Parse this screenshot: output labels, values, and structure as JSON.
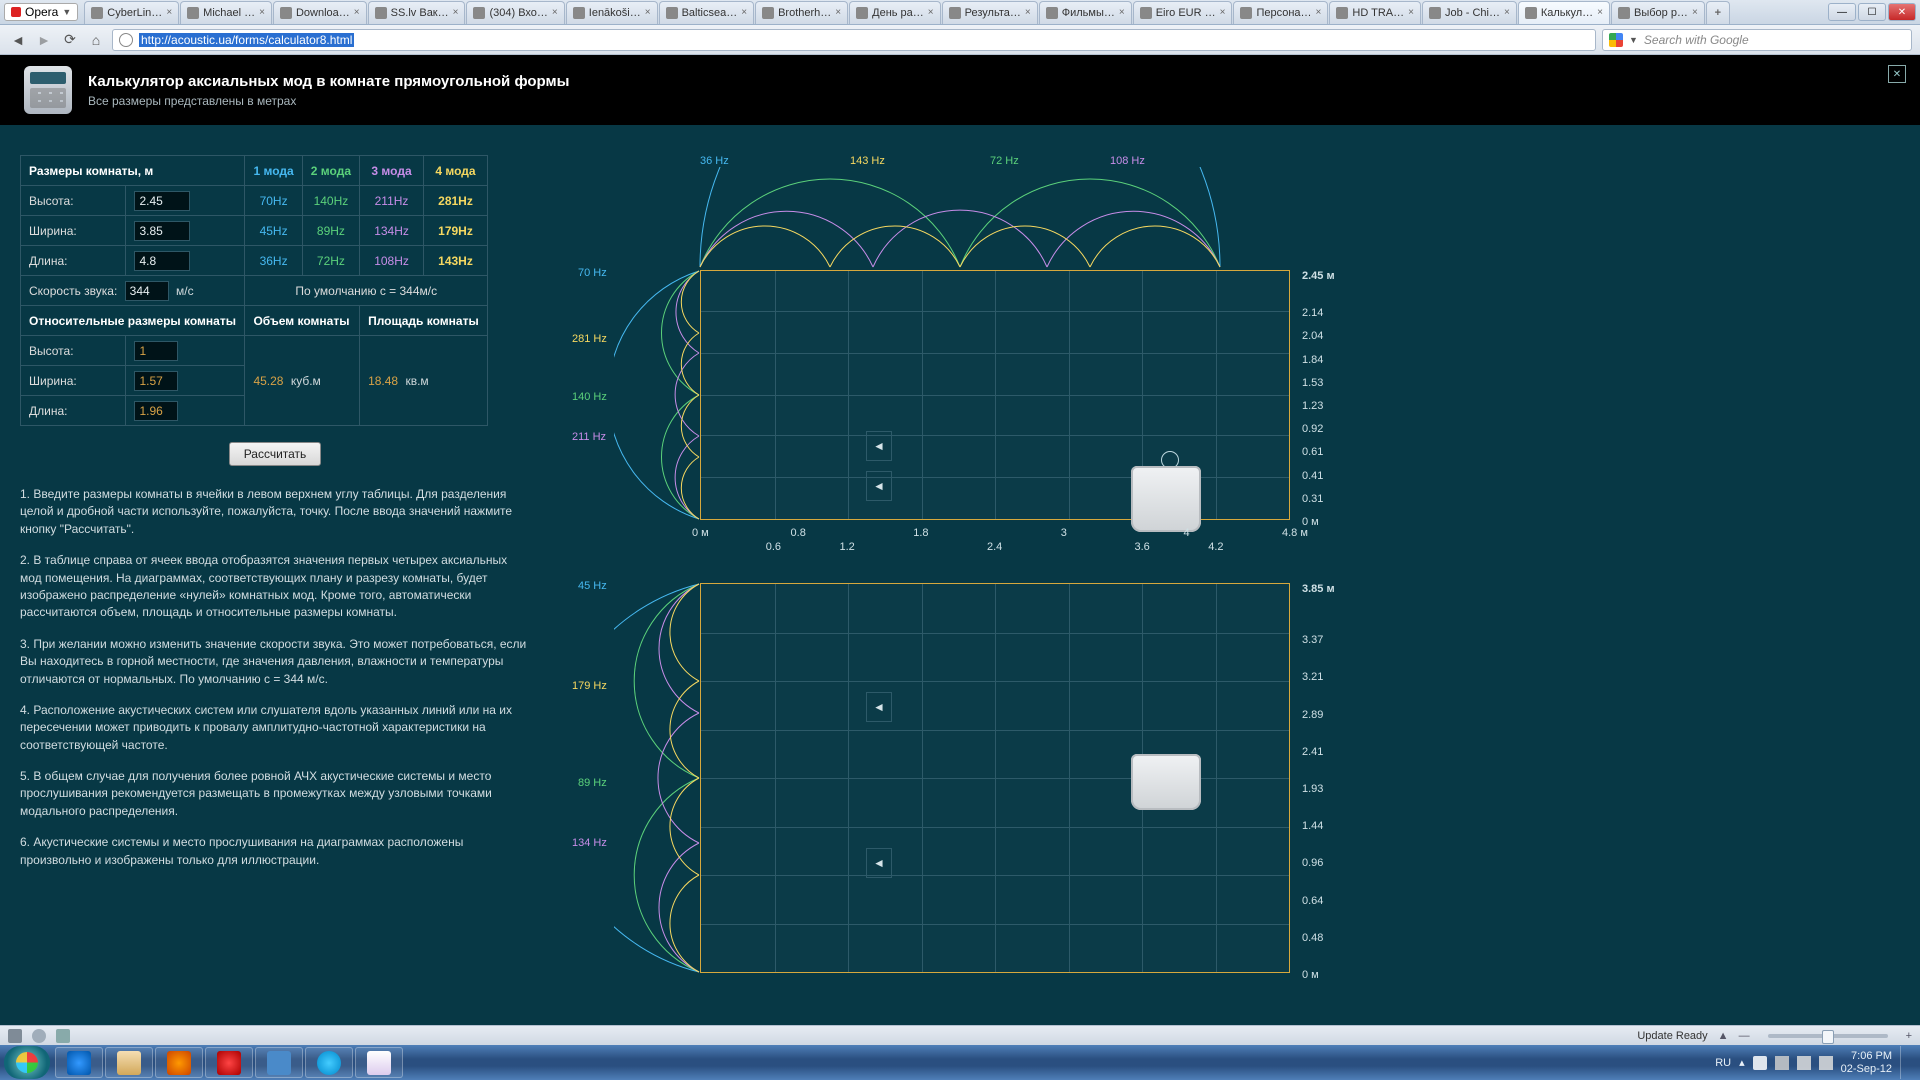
{
  "window": {
    "app": "Opera",
    "tabs": [
      "CyberLin…",
      "Michael …",
      "Downloa…",
      "SS.lv Вак…",
      "(304) Вхо…",
      "Ienākoši…",
      "Balticsea…",
      "Brotherh…",
      "День ра…",
      "Результа…",
      "Фильмы…",
      "Eiro EUR …",
      "Персона…",
      "HD TRA…",
      "Job - Chi…",
      "Калькул…",
      "Выбор р…"
    ],
    "active_tab": 15,
    "url": "http://acoustic.ua/forms/calculator8.html",
    "search_placeholder": "Search with Google",
    "min": "—",
    "max": "☐",
    "close": "✕"
  },
  "header": {
    "title": "Калькулятор аксиальных мод в комнате прямоугольной формы",
    "subtitle": "Все размеры представлены в метрах"
  },
  "table": {
    "room_dims_header": "Размеры комнаты, м",
    "m1": "1 мода",
    "m2": "2 мода",
    "m3": "3 мода",
    "m4": "4 мода",
    "h_label": "Высота:",
    "w_label": "Ширина:",
    "l_label": "Длина:",
    "h": "2.45",
    "w": "3.85",
    "l": "4.8",
    "row_h": [
      "70Hz",
      "140Hz",
      "211Hz",
      "281Hz"
    ],
    "row_w": [
      "45Hz",
      "89Hz",
      "134Hz",
      "179Hz"
    ],
    "row_l": [
      "36Hz",
      "72Hz",
      "108Hz",
      "143Hz"
    ],
    "speed_label": "Скорость звука:",
    "speed": "344",
    "speed_unit": "м/с",
    "speed_note": "По  умолчанию с = 344м/с",
    "rel_header": "Относительные размеры комнаты",
    "vol_header": "Объем комнаты",
    "area_header": "Площадь комнаты",
    "rel_h": "1",
    "rel_w": "1.57",
    "rel_l": "1.96",
    "volume": "45.28",
    "vol_unit": "куб.м",
    "area": "18.48",
    "area_unit": "кв.м",
    "calc_btn": "Рассчитать"
  },
  "instructions": [
    "1. Введите размеры комнаты в ячейки в левом верхнем углу таблицы. Для разделения целой и дробной части используйте, пожалуйста, точку. После ввода значений нажмите кнопку \"Рассчитать\".",
    "2. В таблице справа от ячеек ввода отобразятся значения первых четырех аксиальных мод помещения. На диаграммах, соответствующих плану и разрезу комнаты, будет изображено распределение «нулей» комнатных мод. Кроме того, автоматически рассчитаются объем, площадь и относительные размеры комнаты.",
    "3. При желании можно изменить значение скорости звука. Это может потребоваться, если Вы находитесь в горной местности, где значения давления, влажности и температуры отличаются от нормальных. По умолчанию с = 344 м/с.",
    "4. Расположение акустических систем или слушателя вдоль указанных линий или на их пересечении может приводить к провалу амплитудно-частотной характеристики на соответствующей частоте.",
    "5. В общем случае для получения более ровной АЧХ акустические системы и место прослушивания рекомендуется размещать в промежутках между узловыми точками модального распределения.",
    "6. Акустические системы и место прослушивания на диаграммах расположены произвольно и изображены только для иллюстрации."
  ],
  "diagram": {
    "top_freq": [
      "36 Hz",
      "143 Hz",
      "72 Hz",
      "108 Hz"
    ],
    "side_freq_upper": [
      "70 Hz",
      "281 Hz",
      "140 Hz",
      "211 Hz"
    ],
    "side_freq_lower": [
      "45 Hz",
      "179 Hz",
      "89 Hz",
      "134 Hz"
    ],
    "upper_right_header": "2.45 м",
    "lower_right_header": "3.85 м",
    "x_ticks": [
      "0 м",
      "0.6",
      "0.8",
      "1.2",
      "1.8",
      "2.4",
      "3",
      "3.6",
      "4",
      "4.2",
      "4.8 м"
    ],
    "upper_y": [
      "2.14",
      "2.04",
      "1.84",
      "1.53",
      "1.23",
      "0.92",
      "0.61",
      "0.41",
      "0.31",
      "0 м"
    ],
    "lower_y": [
      "3.37",
      "3.21",
      "2.89",
      "2.41",
      "1.93",
      "1.44",
      "0.96",
      "0.64",
      "0.48",
      "0 м"
    ]
  },
  "status": {
    "update": "Update Ready",
    "lang": "RU",
    "time": "7:06 PM",
    "date": "02-Sep-12"
  }
}
